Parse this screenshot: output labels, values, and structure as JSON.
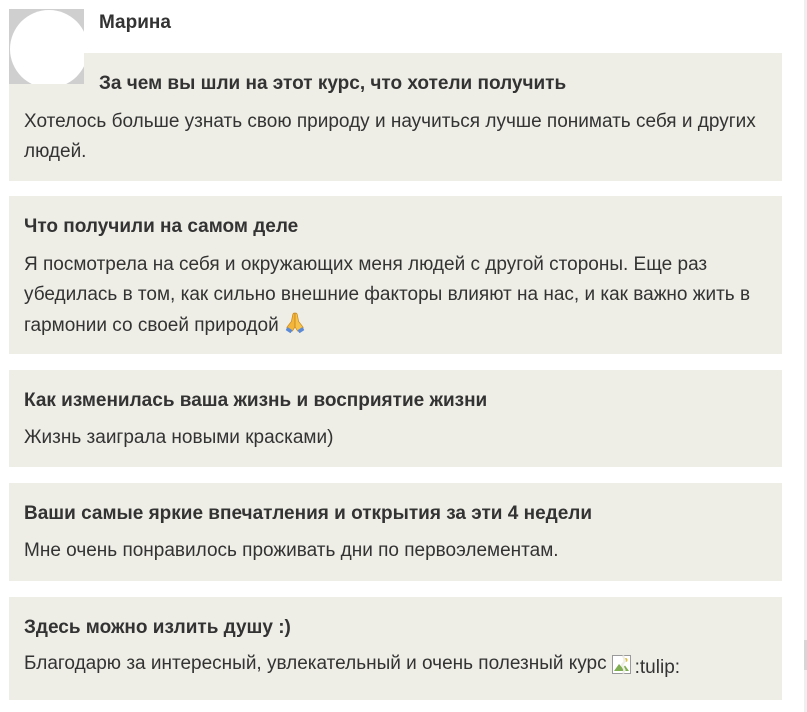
{
  "author": {
    "name": "Марина"
  },
  "cards": [
    {
      "title": "За чем вы шли на этот курс, что хотели получить",
      "text": "Хотелось больше узнать свою природу и научиться лучше понимать себя и других людей."
    },
    {
      "title": "Что получили на самом деле",
      "text": "Я посмотрела на себя и окружающих меня людей с другой стороны. Еще раз убедилась в том, как сильно внешние факторы влияют на нас, и как важно жить в гармонии со своей природой"
    },
    {
      "title": "Как изменилась ваша жизнь и восприятие жизни",
      "text": "Жизнь заиграла новыми красками)"
    },
    {
      "title": "Ваши самые яркие впечатления и открытия за эти 4 недели",
      "text": "Мне очень понравилось проживать дни по первоэлементам."
    },
    {
      "title": "Здесь можно излить душу :)",
      "text": "Благодарю за интересный, увлекательный и очень полезный курс",
      "image_alt": ":tulip:"
    }
  ],
  "icons": {
    "pray": "folded-hands-emoji",
    "broken": "broken-image-icon"
  },
  "colors": {
    "card_background": "#eeede6",
    "text": "#333333",
    "page_background": "#ffffff"
  }
}
